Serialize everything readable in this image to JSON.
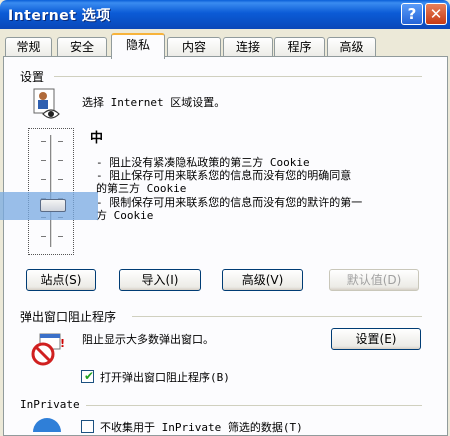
{
  "window": {
    "title": "Internet 选项",
    "help_glyph": "?",
    "close_glyph": "✕"
  },
  "tabs": [
    "常规",
    "安全",
    "隐私",
    "内容",
    "连接",
    "程序",
    "高级"
  ],
  "active_tab": "隐私",
  "settings": {
    "group_label": "设置",
    "zone_text": "选择 Internet 区域设置。",
    "level": "中",
    "descriptions": [
      "- 阻止没有紧凑隐私政策的第三方 Cookie",
      "- 阻止保存可用来联系您的信息而没有您的明确同意",
      "的第三方 Cookie",
      "- 限制保存可用来联系您的信息而没有您的默许的第一",
      "方 Cookie"
    ],
    "buttons": {
      "sites": "站点(S)",
      "import": "导入(I)",
      "advanced": "高级(V)",
      "default": "默认值(D)"
    }
  },
  "popup": {
    "group_label": "弹出窗口阻止程序",
    "description": "阻止显示大多数弹出窗口。",
    "settings_button": "设置(E)",
    "checkbox_label": "打开弹出窗口阻止程序(B)",
    "checkbox_checked": true
  },
  "inprivate": {
    "group_label": "InPrivate",
    "checkbox_label": "不收集用于 InPrivate 筛选的数据(T)"
  },
  "colors": {
    "title_bar": "#0a5fd8",
    "tab_highlight": "#f7b33b",
    "dialog_bg": "#ece9d8"
  }
}
